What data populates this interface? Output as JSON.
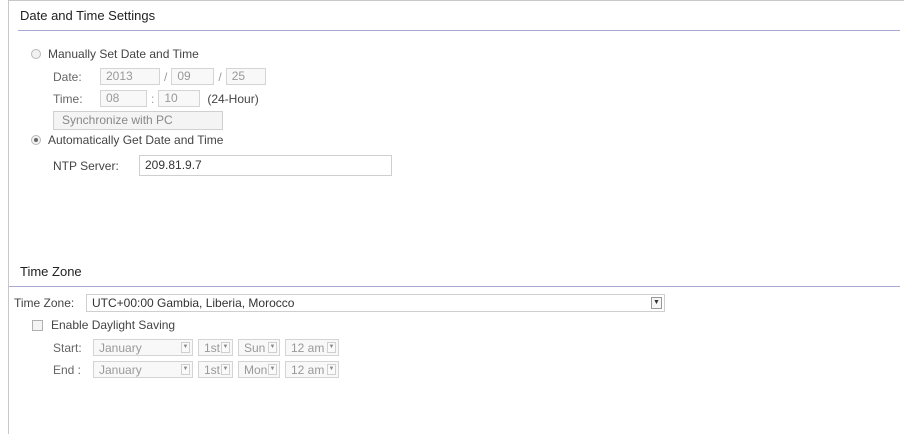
{
  "date_time": {
    "title": "Date and Time Settings",
    "manual": {
      "label": "Manually Set Date and Time",
      "selected": false,
      "date_label": "Date:",
      "year": "2013",
      "month": "09",
      "day": "25",
      "date_sep": "/",
      "time_label": "Time:",
      "hour": "08",
      "minute": "10",
      "time_sep": ":",
      "time_format": "(24-Hour)",
      "sync_button": "Synchronize with PC"
    },
    "auto": {
      "label": "Automatically Get Date and Time",
      "selected": true,
      "ntp_label": "NTP Server:",
      "ntp_value": "209.81.9.7"
    }
  },
  "time_zone": {
    "title": "Time Zone",
    "label": "Time Zone:",
    "value": "UTC+00:00 Gambia, Liberia, Morocco",
    "dst": {
      "label": "Enable Daylight Saving",
      "checked": false,
      "start_label": "Start:",
      "start": {
        "month": "January",
        "week": "1st",
        "day": "Sun",
        "hour": "12 am"
      },
      "end_label": "End :",
      "end": {
        "month": "January",
        "week": "1st",
        "day": "Mon",
        "hour": "12 am"
      }
    }
  },
  "icons": {
    "dropdown": "chevron-down-icon"
  },
  "colors": {
    "section_rule": "#a9a9d4",
    "disabled_text": "#999999"
  }
}
